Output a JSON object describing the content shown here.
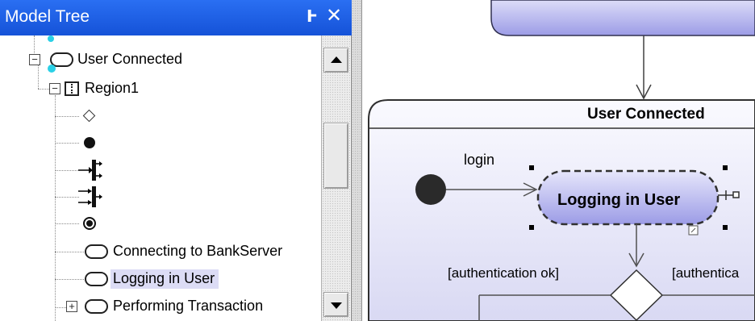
{
  "panel": {
    "title": "Model Tree",
    "pin_glyph": "Ͱ",
    "close_glyph": "✕"
  },
  "tree": {
    "rows": [
      {
        "label": "User Connected",
        "icon": "state-icon",
        "expanded": true
      },
      {
        "label": "Region1",
        "icon": "region-icon",
        "expanded": true
      },
      {
        "label": "",
        "icon": "choice-diamond-icon"
      },
      {
        "label": "",
        "icon": "initial-state-icon"
      },
      {
        "label": "",
        "icon": "fork-icon"
      },
      {
        "label": "",
        "icon": "join-icon"
      },
      {
        "label": "",
        "icon": "final-state-icon"
      },
      {
        "label": "Connecting to BankServer",
        "icon": "state-icon"
      },
      {
        "label": "Logging in User",
        "icon": "state-icon",
        "selected": true
      },
      {
        "label": "Performing Transaction",
        "icon": "state-icon",
        "expanded": false
      }
    ]
  },
  "diagram": {
    "composite_state_title": "User Connected",
    "selected_state": "Logging in User",
    "transition_login": "login",
    "guard_ok": "[authentication ok]",
    "guard_other": "[authentica"
  },
  "colors": {
    "titlebar": "#1a5fe8",
    "selection": "#dcdcf5",
    "state_fill_top": "#e6e6fb",
    "state_fill_bottom": "#9c9ce6",
    "connector_dot": "#2ad0e6"
  }
}
